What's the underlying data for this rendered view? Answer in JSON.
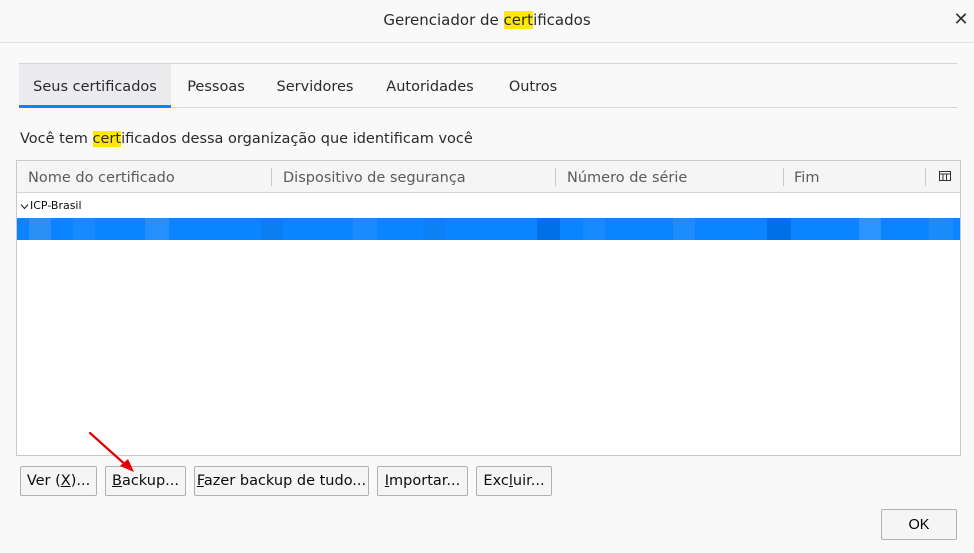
{
  "window": {
    "title_pre": "Gerenciador de ",
    "title_hl": "cert",
    "title_post": "ificados",
    "close_glyph": "✕"
  },
  "tabs": [
    {
      "label": "Seus certificados",
      "active": true
    },
    {
      "label": "Pessoas"
    },
    {
      "label": "Servidores"
    },
    {
      "label": "Autoridades"
    },
    {
      "label": "Outros"
    }
  ],
  "description": {
    "pre": "Você tem ",
    "hl": "cert",
    "post": "ificados dessa organização que identificam você"
  },
  "table": {
    "columns": [
      "Nome do certificado",
      "Dispositivo de segurança",
      "Número de série",
      "Fim"
    ],
    "group": "ICP-Brasil",
    "selected_row_color": "#0a84ff"
  },
  "buttons": {
    "view": {
      "pre": "Ver (",
      "u": "X",
      "post": ")..."
    },
    "backup": {
      "u": "B",
      "post": "ackup..."
    },
    "backup_all": {
      "u": "F",
      "post": "azer backup de tudo..."
    },
    "import": {
      "u": "I",
      "post": "mportar..."
    },
    "delete": {
      "pre": "Exc",
      "u": "l",
      "post": "uir..."
    },
    "ok": "OK"
  },
  "colors": {
    "accent": "#0a84ff",
    "highlight": "#ffe900",
    "annotation_arrow": "#e00000"
  }
}
